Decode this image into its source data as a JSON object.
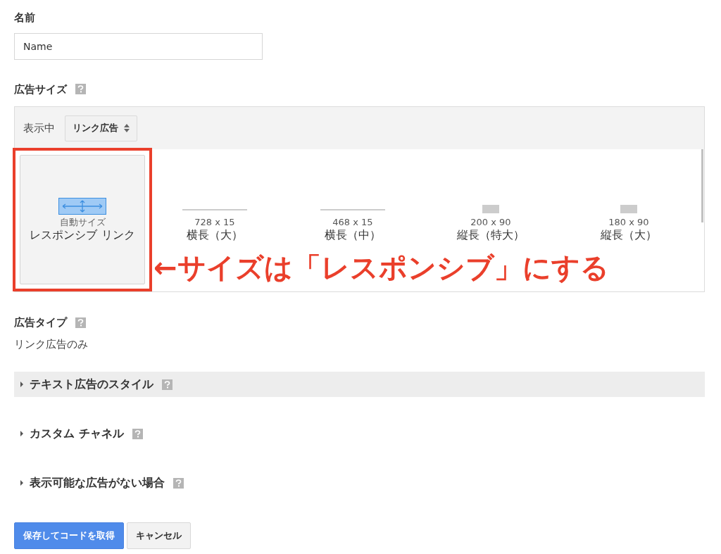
{
  "name_field": {
    "label": "名前",
    "value": "Name"
  },
  "ad_size": {
    "label": "広告サイズ",
    "showing_label": "表示中",
    "filter": "リンク広告",
    "sizes": [
      {
        "kind": "responsive",
        "selected": true,
        "caption": "自動サイズ",
        "title": "レスポンシブ リンク"
      },
      {
        "kind": "horizontal",
        "selected": false,
        "caption": "728 x 15",
        "title": "横長（大）"
      },
      {
        "kind": "horizontal",
        "selected": false,
        "caption": "468 x 15",
        "title": "横長（中）"
      },
      {
        "kind": "vertical",
        "selected": false,
        "caption": "200 x 90",
        "title": "縦長（特大）"
      },
      {
        "kind": "vertical",
        "selected": false,
        "caption": "180 x 90",
        "title": "縦長（大）"
      }
    ],
    "annotation": "←サイズは「レスポンシブ」にする"
  },
  "ad_type": {
    "label": "広告タイプ",
    "value": "リンク広告のみ"
  },
  "sections": [
    {
      "label": "テキスト広告のスタイル",
      "highlighted": true,
      "expanded": false
    },
    {
      "label": "カスタム チャネル",
      "highlighted": false,
      "expanded": false
    },
    {
      "label": "表示可能な広告がない場合",
      "highlighted": false,
      "expanded": false
    }
  ],
  "buttons": [
    {
      "kind": "primary",
      "label": "保存してコードを取得"
    },
    {
      "kind": "secondary",
      "label": "キャンセル"
    }
  ]
}
